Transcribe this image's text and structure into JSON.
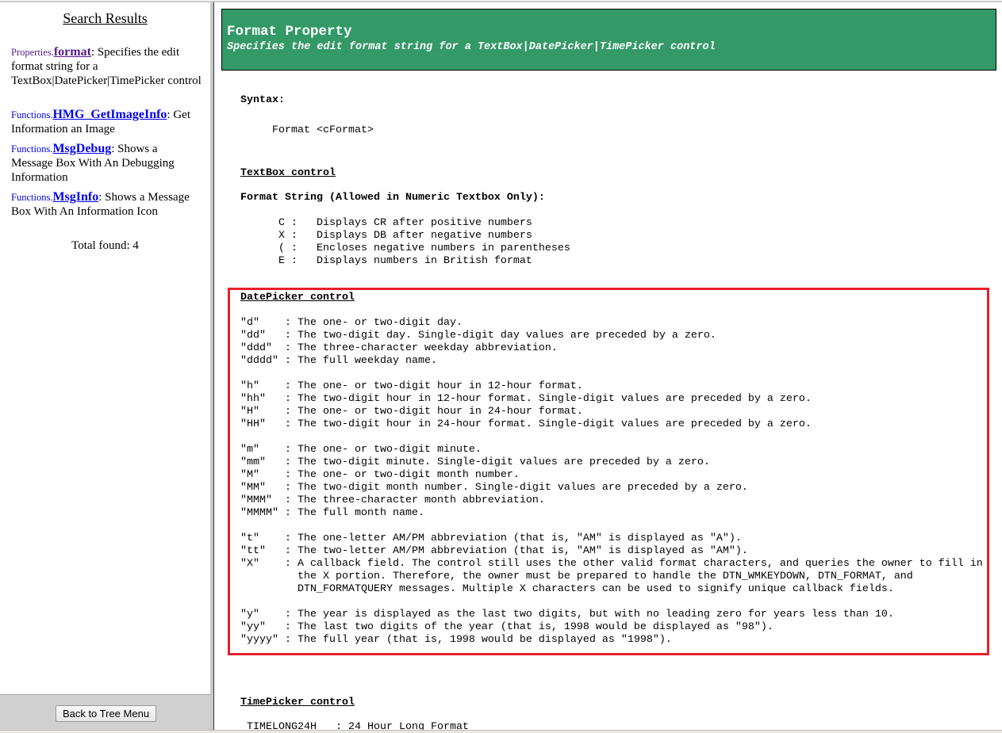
{
  "left": {
    "title": "Search Results",
    "results": [
      {
        "category": "Properties.",
        "name": "format",
        "desc": ": Specifies the edit format string for a TextBox|DatePicker|TimePicker control"
      },
      {
        "category": "Functions.",
        "name": "HMG_GetImageInfo",
        "desc": ": Get Information an Image"
      },
      {
        "category": "Functions.",
        "name": "MsgDebug",
        "desc": ": Shows a Message Box With An Debugging Information"
      },
      {
        "category": "Functions.",
        "name": "MsgInfo",
        "desc": ": Shows a Message Box With An Information Icon"
      }
    ],
    "total": "Total found: 4",
    "back_button": "Back to Tree Menu"
  },
  "doc": {
    "title": "Format Property",
    "subtitle": "Specifies the edit format string for a TextBox|DatePicker|TimePicker control",
    "syntax_label": "Syntax:",
    "syntax": "Format <cFormat>",
    "textbox_heading": "TextBox control",
    "format_string_label": "Format String (Allowed in Numeric Textbox Only):",
    "textbox_lines": [
      "C :   Displays CR after positive numbers",
      "X :   Displays DB after negative numbers",
      "( :   Encloses negative numbers in parentheses",
      "E :   Displays numbers in British format"
    ],
    "datepicker_heading": "DatePicker control",
    "datepicker_lines": [
      "\"d\"    : The one- or two-digit day.",
      "\"dd\"   : The two-digit day. Single-digit day values are preceded by a zero.",
      "\"ddd\"  : The three-character weekday abbreviation.",
      "\"dddd\" : The full weekday name.",
      "",
      "\"h\"    : The one- or two-digit hour in 12-hour format.",
      "\"hh\"   : The two-digit hour in 12-hour format. Single-digit values are preceded by a zero.",
      "\"H\"    : The one- or two-digit hour in 24-hour format.",
      "\"HH\"   : The two-digit hour in 24-hour format. Single-digit values are preceded by a zero.",
      "",
      "\"m\"    : The one- or two-digit minute.",
      "\"mm\"   : The two-digit minute. Single-digit values are preceded by a zero.",
      "\"M\"    : The one- or two-digit month number.",
      "\"MM\"   : The two-digit month number. Single-digit values are preceded by a zero.",
      "\"MMM\"  : The three-character month abbreviation.",
      "\"MMMM\" : The full month name.",
      "",
      "\"t\"    : The one-letter AM/PM abbreviation (that is, \"AM\" is displayed as \"A\").",
      "\"tt\"   : The two-letter AM/PM abbreviation (that is, \"AM\" is displayed as \"AM\").",
      "\"X\"    : A callback field. The control still uses the other valid format characters, and queries the owner to fill in",
      "         the X portion. Therefore, the owner must be prepared to handle the DTN_WMKEYDOWN, DTN_FORMAT, and",
      "         DTN_FORMATQUERY messages. Multiple X characters can be used to signify unique callback fields.",
      "",
      "\"y\"    : The year is displayed as the last two digits, but with no leading zero for years less than 10.",
      "\"yy\"   : The last two digits of the year (that is, 1998 would be displayed as \"98\").",
      "\"yyyy\" : The full year (that is, 1998 would be displayed as \"1998\")."
    ],
    "timepicker_heading": "TimePicker control",
    "timepicker_lines": [
      " TIMELONG24H   : 24 Hour Long Format"
    ]
  },
  "colors": {
    "header_bg": "#339966",
    "highlight_border": "#e8202a",
    "link": "#0000ee",
    "visited": "#551a8b"
  }
}
